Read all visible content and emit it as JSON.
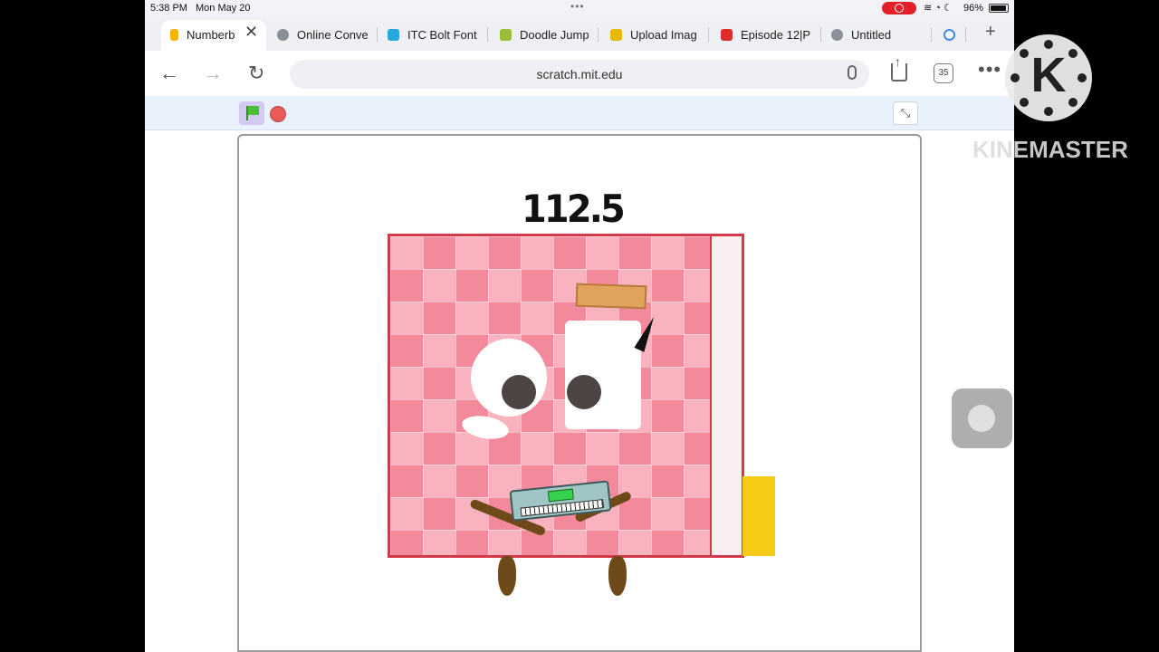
{
  "status_bar": {
    "time": "5:38 PM",
    "date": "Mon May 20",
    "dots": "•••",
    "battery": "96%"
  },
  "tabs": [
    {
      "label": "Numberb",
      "favicon_color": "#f4b400",
      "active": true
    },
    {
      "label": "Online Conve",
      "favicon_color": "#8a8f98",
      "active": false
    },
    {
      "label": "ITC Bolt Font",
      "favicon_color": "#29a8e0",
      "active": false
    },
    {
      "label": "Doodle Jump",
      "favicon_color": "#9bbd3a",
      "active": false
    },
    {
      "label": "Upload Imag",
      "favicon_color": "#e8b700",
      "active": false
    },
    {
      "label": "Episode 12|P",
      "favicon_color": "#e02b2b",
      "active": false
    },
    {
      "label": "Untitled",
      "favicon_color": "#8a8f98",
      "active": false
    }
  ],
  "toolbar": {
    "url": "scratch.mit.edu",
    "tab_count": "35"
  },
  "stage": {
    "number_label": "112.5",
    "colors": {
      "block_border": "#d23a4b",
      "block_dark": "#f38a9b",
      "block_light": "#f8b3bf",
      "accent_yellow": "#f6cb17",
      "limbs": "#6e4a1a"
    }
  },
  "watermark": {
    "logo_letter": "K",
    "brand": "KINEMASTER"
  },
  "icons": [
    "back-arrow-icon",
    "forward-arrow-icon",
    "reload-icon",
    "mic-icon",
    "share-icon",
    "more-icon",
    "green-flag-icon",
    "stop-icon",
    "exit-fullscreen-icon"
  ]
}
